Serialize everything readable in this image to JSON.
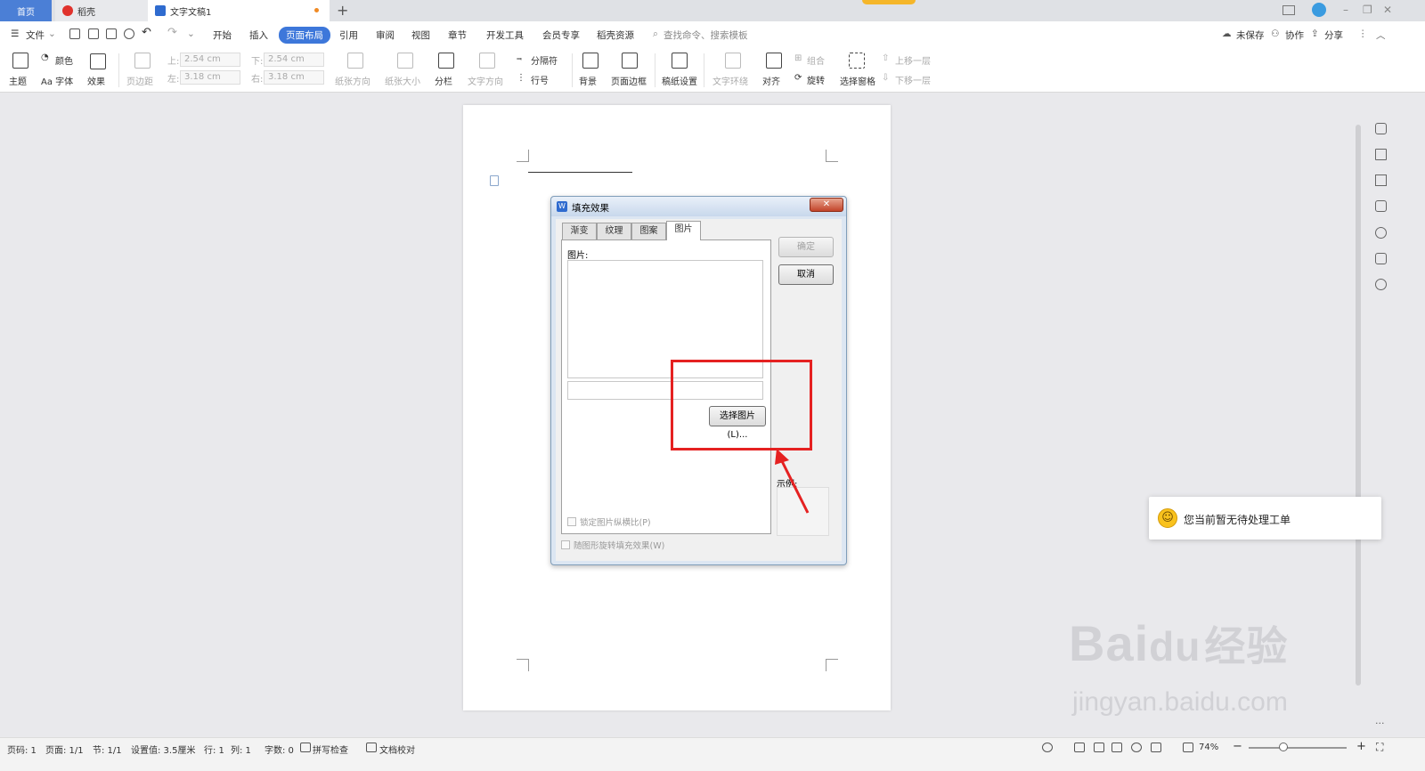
{
  "tabs": {
    "home": "首页",
    "daoke": "稻壳",
    "doc": "文字文稿1",
    "add": "+"
  },
  "window_controls": {
    "minimize": "–",
    "restore": "❐",
    "close": "✕"
  },
  "menu": {
    "file": "文件",
    "items": [
      "开始",
      "插入",
      "页面布局",
      "引用",
      "审阅",
      "视图",
      "章节",
      "开发工具",
      "会员专享",
      "稻壳资源"
    ],
    "active": "页面布局",
    "search_placeholder": "查找命令、搜索模板",
    "unsaved": "未保存",
    "collaborate": "协作",
    "share": "分享"
  },
  "ribbon": {
    "theme": "主题",
    "color": "颜色",
    "font": "Aa 字体",
    "effect": "效果",
    "margins": "页边距",
    "margin_top_label": "上:",
    "margin_top": "2.54 cm",
    "margin_bottom_label": "下:",
    "margin_bottom": "2.54 cm",
    "margin_left_label": "左:",
    "margin_left": "3.18 cm",
    "margin_right_label": "右:",
    "margin_right": "3.18 cm",
    "orientation": "纸张方向",
    "size": "纸张大小",
    "columns": "分栏",
    "text_direction": "文字方向",
    "separator": "分隔符",
    "line_number": "行号",
    "background": "背景",
    "page_border": "页面边框",
    "paper_setup": "稿纸设置",
    "text_wrap": "文字环绕",
    "align": "对齐",
    "group": "组合",
    "rotate": "旋转",
    "selection_pane": "选择窗格",
    "bring_forward": "上移一层",
    "send_backward": "下移一层"
  },
  "dialog": {
    "title": "填充效果",
    "close": "✕",
    "tabs": [
      "渐变",
      "纹理",
      "图案",
      "图片"
    ],
    "active_tab": "图片",
    "picture_label": "图片:",
    "select_picture": "选择图片(L)...",
    "lock_aspect": "锁定图片纵横比(P)",
    "rotate_with_shape": "随图形旋转填充效果(W)",
    "ok": "确定",
    "cancel": "取消",
    "preview_label": "示例:"
  },
  "toast": {
    "icon": "smiley-icon",
    "text": "您当前暂无待处理工单"
  },
  "watermark": {
    "main": "Bai",
    "paw": "du",
    "cn": "经验",
    "sub": "jingyan.baidu.com"
  },
  "status": {
    "page": "页码: 1",
    "pages": "页面: 1/1",
    "section": "节: 1/1",
    "setting": "设置值: 3.5厘米",
    "row": "行: 1",
    "col": "列: 1",
    "words": "字数: 0",
    "spell": "拼写检查",
    "proof": "文档校对",
    "zoom": "74%"
  },
  "colors": {
    "accent": "#3d77da",
    "highlight": "#e52121",
    "toast_icon": "#f9c21d"
  }
}
